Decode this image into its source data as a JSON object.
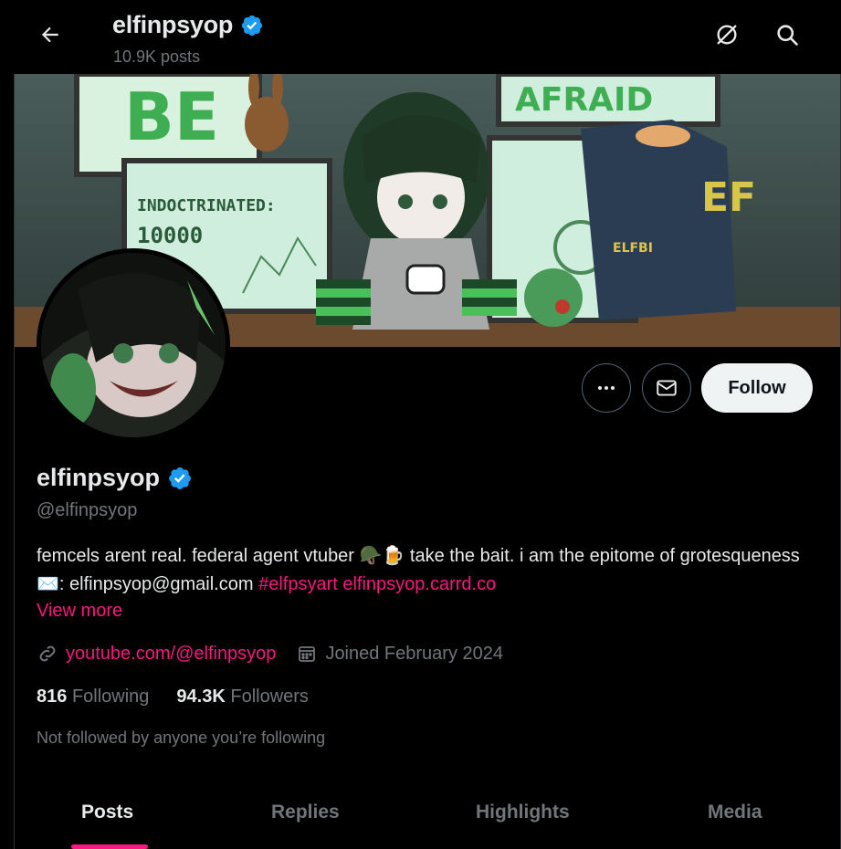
{
  "header": {
    "name": "elfinpsyop",
    "posts_count": "10.9K posts",
    "icons": [
      "back-arrow-icon",
      "grok-icon",
      "search-icon"
    ]
  },
  "banner": {
    "texts": [
      "BE",
      "AFRAID",
      "INDOCTRINATED:",
      "10000",
      "ELFBI"
    ]
  },
  "profile": {
    "display_name": "elfinpsyop",
    "verified": true,
    "handle": "@elfinpsyop",
    "bio_part1": "femcels arent real. federal agent vtuber 🪖🍺 take the bait. i am the epitome of grotesqueness ✉️: elfinpsyop@gmail.com",
    "bio_hashtag": "#elfpsyart",
    "bio_link": "elfinpsyop.carrd.co",
    "view_more": "View more",
    "website": "youtube.com/@elfinpsyop",
    "joined": "Joined February 2024",
    "following_count": "816",
    "following_label": "Following",
    "followers_count": "94.3K",
    "followers_label": "Followers",
    "not_followed": "Not followed by anyone you’re following"
  },
  "actions": {
    "follow_label": "Follow",
    "icons": [
      "more-icon",
      "message-icon"
    ]
  },
  "tabs": [
    {
      "label": "Posts",
      "active": true
    },
    {
      "label": "Replies",
      "active": false
    },
    {
      "label": "Highlights",
      "active": false
    },
    {
      "label": "Media",
      "active": false
    }
  ],
  "colors": {
    "accent": "#f91880",
    "verified": "#1d9bf0",
    "background": "#000000",
    "muted": "#71767b"
  }
}
